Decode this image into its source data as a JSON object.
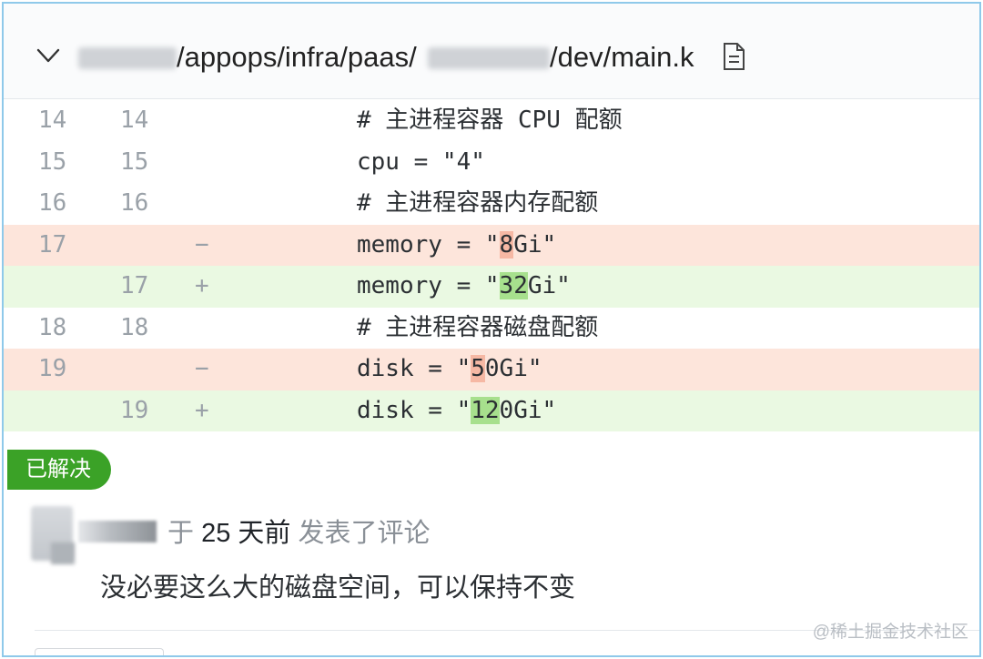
{
  "file_header": {
    "path_part_1": "/appops/infra/paas/",
    "path_part_2": "/dev/main.k",
    "collapse_icon": "chevron-down-icon",
    "file_icon": "file-icon"
  },
  "diff_rows": [
    {
      "type": "context",
      "old": "14",
      "new": "14",
      "mark": "",
      "pre": "# 主进程容器 CPU 配额",
      "hl": "",
      "post": ""
    },
    {
      "type": "context",
      "old": "15",
      "new": "15",
      "mark": "",
      "pre": "cpu = \"4\"",
      "hl": "",
      "post": ""
    },
    {
      "type": "context",
      "old": "16",
      "new": "16",
      "mark": "",
      "pre": "# 主进程容器内存配额",
      "hl": "",
      "post": ""
    },
    {
      "type": "del",
      "old": "17",
      "new": "",
      "mark": "−",
      "pre": "memory = \"",
      "hl": "8",
      "post": "Gi\""
    },
    {
      "type": "add",
      "old": "",
      "new": "17",
      "mark": "+",
      "pre": "memory = \"",
      "hl": "32",
      "post": "Gi\""
    },
    {
      "type": "context",
      "old": "18",
      "new": "18",
      "mark": "",
      "pre": "# 主进程容器磁盘配额",
      "hl": "",
      "post": ""
    },
    {
      "type": "del",
      "old": "19",
      "new": "",
      "mark": "−",
      "pre": "disk = \"",
      "hl": "5",
      "post": "0Gi\""
    },
    {
      "type": "add",
      "old": "",
      "new": "19",
      "mark": "+",
      "pre": "disk = \"",
      "hl": "12",
      "post": "0Gi\""
    }
  ],
  "comment": {
    "status_badge": "已解决",
    "prefix": "于",
    "time": "25 天前",
    "action": "发表了评论",
    "body": "没必要这么大的磁盘空间，可以保持不变"
  },
  "watermark": "@稀土掘金技术社区",
  "colors": {
    "del_bg": "#fde5db",
    "add_bg": "#eaf9e2",
    "badge_green": "#3ba227"
  }
}
